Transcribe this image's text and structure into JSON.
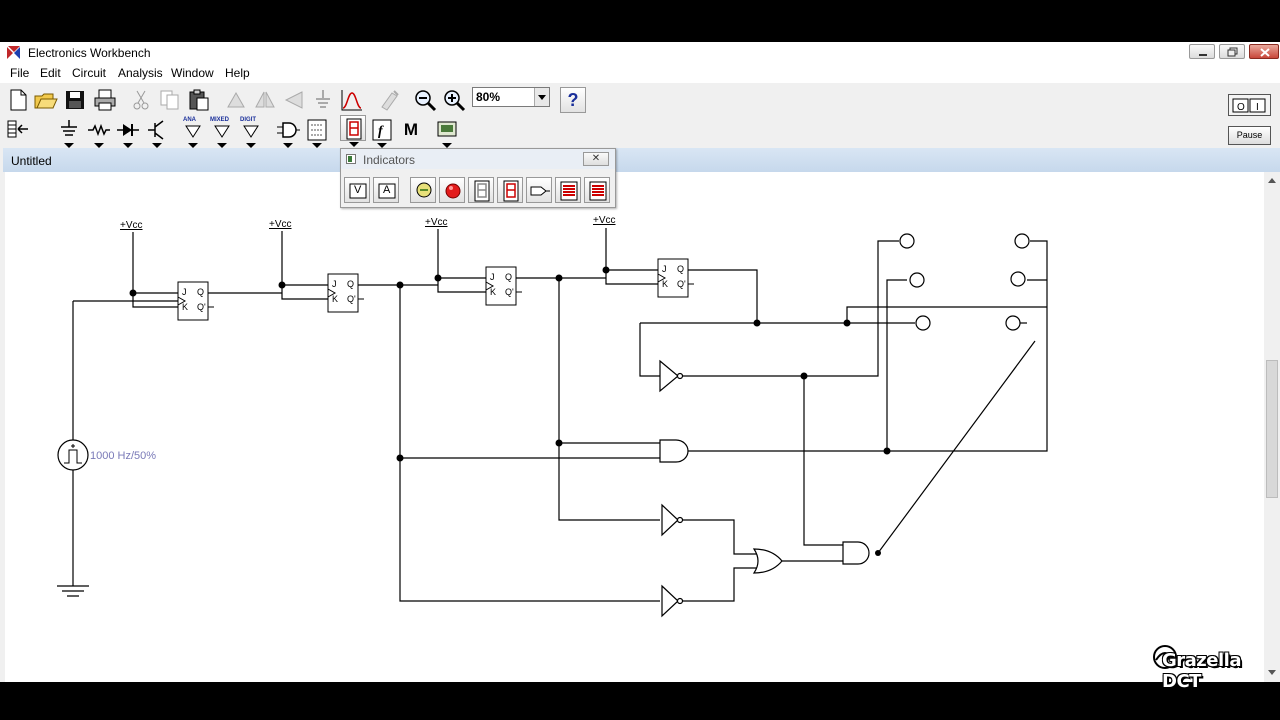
{
  "window": {
    "title": "Electronics Workbench"
  },
  "menu": [
    "File",
    "Edit",
    "Circuit",
    "Analysis",
    "Window",
    "Help"
  ],
  "toolbar": {
    "zoom_value": "80%",
    "help_label": "?",
    "pause_label": "Pause",
    "parts_bin_labels": {
      "analog": "ANA",
      "mixed": "MIXED",
      "digital": "DIGIT",
      "misc": "M"
    }
  },
  "document": {
    "title": "Untitled"
  },
  "indicators_palette": {
    "title": "Indicators",
    "close_label": "✕",
    "voltmeter_label": "V",
    "ammeter_label": "A"
  },
  "circuit": {
    "vcc_labels": [
      "+Vcc",
      "+Vcc",
      "+Vcc",
      "+Vcc"
    ],
    "flipflop_pins": {
      "j": "J",
      "k": "K",
      "q": "Q",
      "qbar": "Q'"
    },
    "clock_source_label": "1000 Hz/50%"
  },
  "watermark": {
    "text": "Grazella DCT"
  }
}
